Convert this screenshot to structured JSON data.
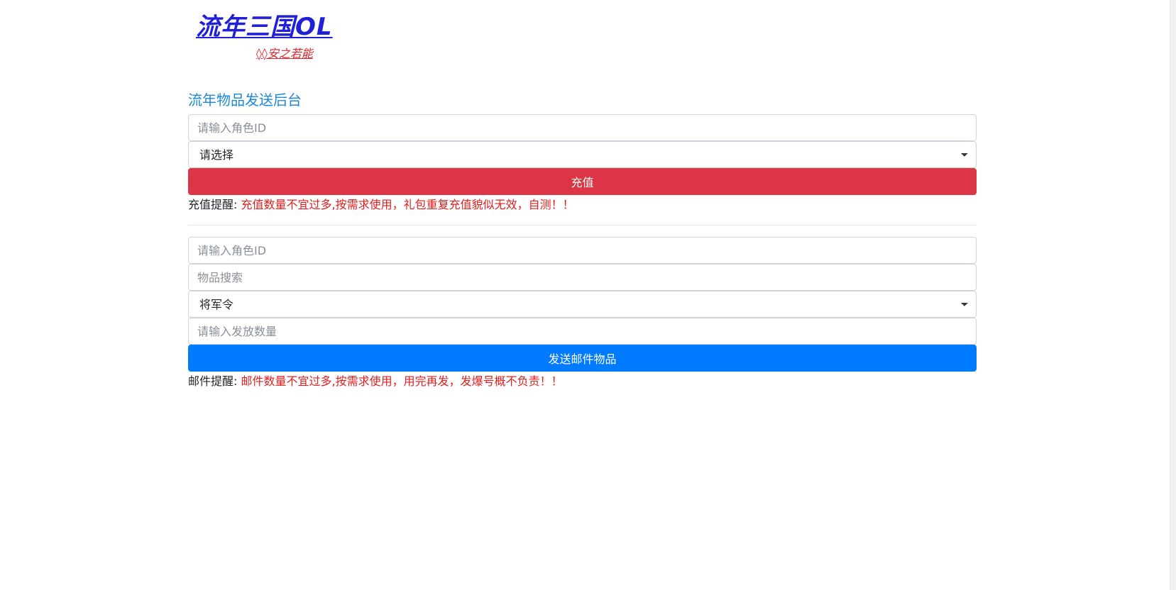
{
  "header": {
    "title": "流年三国OL",
    "subtitle": "◊◊安之若能"
  },
  "recharge": {
    "heading": "流年物品发送后台",
    "role_id_placeholder": "请输入角色ID",
    "package_select_value": "请选择",
    "button_label": "充值",
    "note_label": "充值提醒:",
    "note_text": "充值数量不宜过多,按需求使用，礼包重复充值貌似无效，自测！！"
  },
  "mail": {
    "role_id_placeholder": "请输入角色ID",
    "item_search_placeholder": "物品搜索",
    "item_select_value": "将军令",
    "quantity_placeholder": "请输入发放数量",
    "button_label": "发送邮件物品",
    "note_label": "邮件提醒:",
    "note_text": "邮件数量不宜过多,按需求使用，用完再发，发爆号概不负责！！"
  },
  "colors": {
    "danger": "#dc3545",
    "primary": "#007bff",
    "title_blue": "#2020d8",
    "heading_blue": "#1e88d8",
    "warning_red": "#e01e1e"
  }
}
